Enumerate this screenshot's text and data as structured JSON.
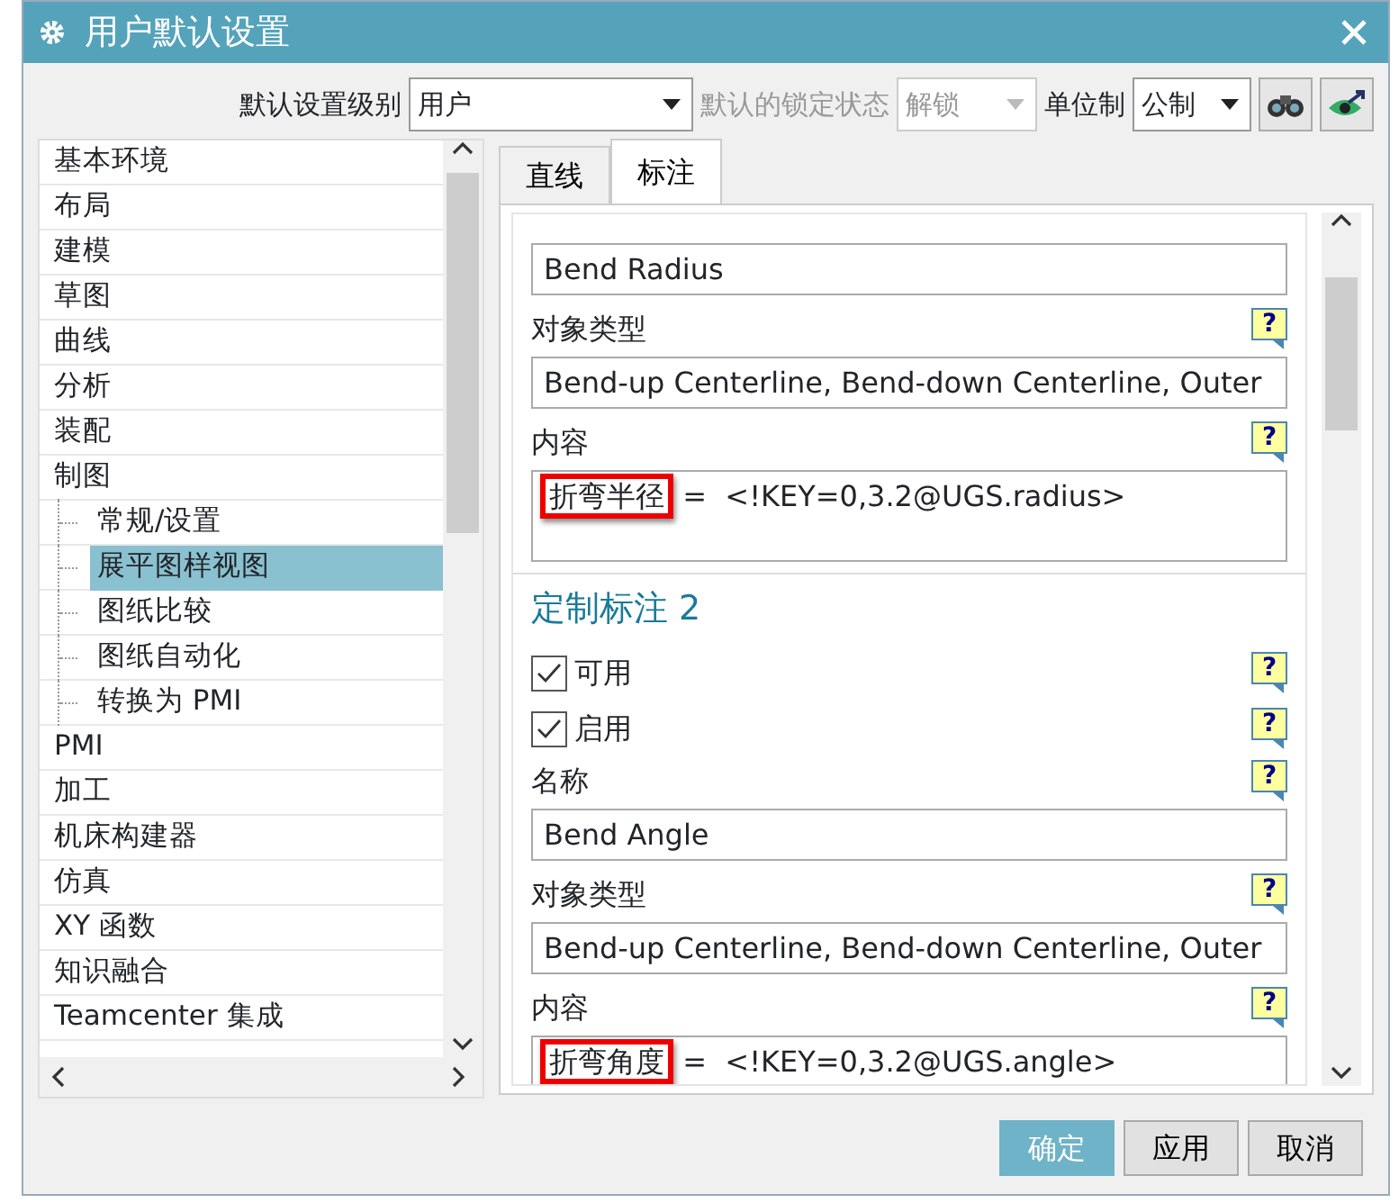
{
  "window": {
    "title": "用户默认设置"
  },
  "toolbar": {
    "level_label": "默认设置级别",
    "level_value": "用户",
    "lock_label": "默认的锁定状态",
    "lock_value": "解锁",
    "lock_disabled": true,
    "unit_label": "单位制",
    "unit_value": "公制"
  },
  "tree": [
    {
      "label": "基本环境",
      "selected": false
    },
    {
      "label": "布局",
      "selected": false
    },
    {
      "label": "建模",
      "selected": false
    },
    {
      "label": "草图",
      "selected": false
    },
    {
      "label": "曲线",
      "selected": false
    },
    {
      "label": "分析",
      "selected": false
    },
    {
      "label": "装配",
      "selected": false
    },
    {
      "label": "制图",
      "selected": false,
      "children": [
        {
          "label": "常规/设置",
          "selected": false
        },
        {
          "label": "展平图样视图",
          "selected": true
        },
        {
          "label": "图纸比较",
          "selected": false
        },
        {
          "label": "图纸自动化",
          "selected": false
        },
        {
          "label": "转换为 PMI",
          "selected": false
        }
      ]
    },
    {
      "label": "PMI",
      "selected": false
    },
    {
      "label": "加工",
      "selected": false
    },
    {
      "label": "机床构建器",
      "selected": false
    },
    {
      "label": "仿真",
      "selected": false
    },
    {
      "label": "XY 函数",
      "selected": false
    },
    {
      "label": "知识融合",
      "selected": false
    },
    {
      "label": "Teamcenter 集成",
      "selected": false
    }
  ],
  "tabs": [
    {
      "label": "直线",
      "selected": false
    },
    {
      "label": "标注",
      "selected": true
    }
  ],
  "settings": [
    {
      "kind": "field",
      "value": "Bend Radius"
    },
    {
      "kind": "label",
      "text": "对象类型",
      "help": "?"
    },
    {
      "kind": "field",
      "value": "Bend-up Centerline, Bend-down Centerline, Outer"
    },
    {
      "kind": "label",
      "text": "内容",
      "help": "?"
    },
    {
      "kind": "content",
      "highlight": "折弯半径",
      "text": " =  <!KEY=0,3.2@UGS.radius>"
    },
    {
      "kind": "heading",
      "text": "定制标注 2"
    },
    {
      "kind": "checkbox",
      "text": "可用",
      "checked": true,
      "help": "?"
    },
    {
      "kind": "checkbox",
      "text": "启用",
      "checked": true,
      "help": "?"
    },
    {
      "kind": "label",
      "text": "名称",
      "help": "?"
    },
    {
      "kind": "field",
      "value": "Bend Angle"
    },
    {
      "kind": "label",
      "text": "对象类型",
      "help": "?"
    },
    {
      "kind": "field",
      "value": "Bend-up Centerline, Bend-down Centerline, Outer"
    },
    {
      "kind": "label",
      "text": "内容",
      "help": "?"
    },
    {
      "kind": "content",
      "highlight": "折弯角度",
      "text": " =  <!KEY=0,3.2@UGS.angle>"
    }
  ],
  "buttons": [
    {
      "label": "确定",
      "kind": "primary"
    },
    {
      "label": "应用",
      "kind": "normal"
    },
    {
      "label": "取消",
      "kind": "normal"
    }
  ]
}
